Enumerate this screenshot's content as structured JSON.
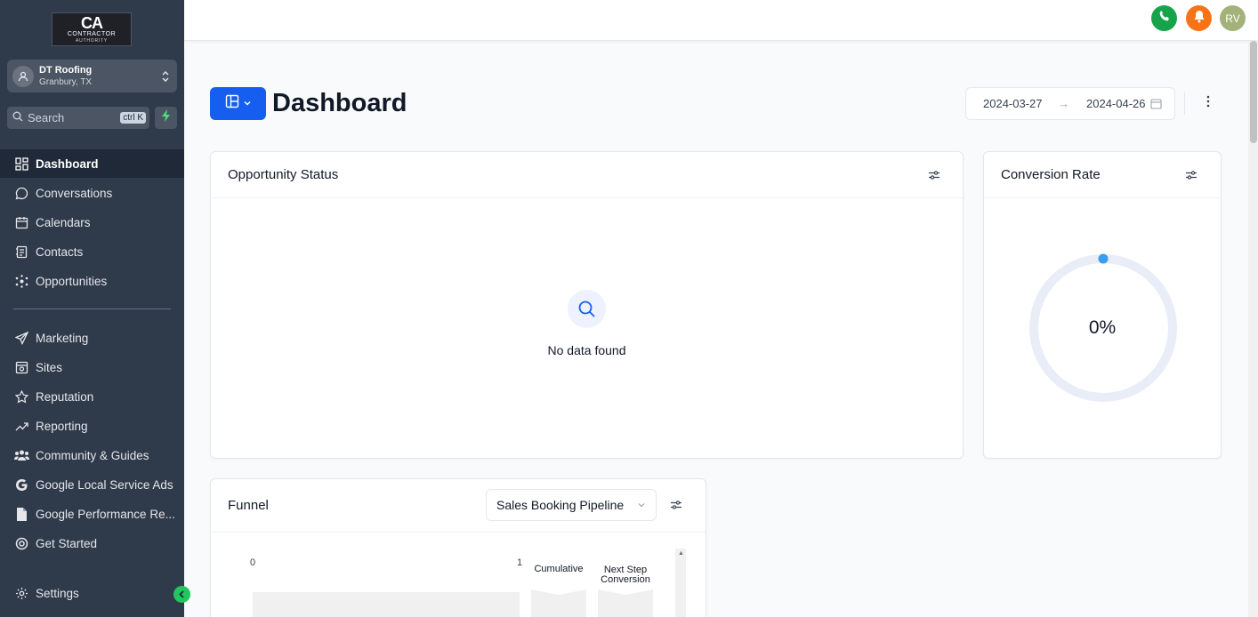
{
  "sidebar": {
    "logo": {
      "main": "CA",
      "sub": "CONTRACTOR",
      "sub2": "AUTHORITY"
    },
    "account": {
      "name": "DT Roofing",
      "location": "Granbury, TX"
    },
    "search": {
      "placeholder": "Search",
      "shortcut": "ctrl K"
    },
    "nav_primary": [
      {
        "label": "Dashboard",
        "icon": "dashboard-icon",
        "active": true
      },
      {
        "label": "Conversations",
        "icon": "chat-icon"
      },
      {
        "label": "Calendars",
        "icon": "calendar-icon"
      },
      {
        "label": "Contacts",
        "icon": "contacts-icon"
      },
      {
        "label": "Opportunities",
        "icon": "opportunities-icon"
      }
    ],
    "nav_secondary": [
      {
        "label": "Marketing",
        "icon": "send-icon"
      },
      {
        "label": "Sites",
        "icon": "sites-icon"
      },
      {
        "label": "Reputation",
        "icon": "star-icon"
      },
      {
        "label": "Reporting",
        "icon": "trend-icon"
      },
      {
        "label": "Community & Guides",
        "icon": "community-icon"
      },
      {
        "label": "Google Local Service Ads",
        "icon": "google-icon"
      },
      {
        "label": "Google Performance Re...",
        "icon": "document-icon"
      },
      {
        "label": "Get Started",
        "icon": "target-icon"
      }
    ],
    "settings_label": "Settings"
  },
  "topbar": {
    "avatar_initials": "RV",
    "colors": {
      "phone": "#16a34a",
      "bell": "#f97316",
      "avatar": "#a3b27a"
    }
  },
  "header": {
    "title": "Dashboard",
    "date_start": "2024-03-27",
    "date_arrow": "→",
    "date_end": "2024-04-26"
  },
  "opportunity_status": {
    "title": "Opportunity Status",
    "empty_message": "No data found"
  },
  "conversion_rate": {
    "title": "Conversion Rate",
    "value_label": "0%",
    "value": 0
  },
  "funnel": {
    "title": "Funnel",
    "pipeline": "Sales Booking Pipeline",
    "axis_min": "0",
    "axis_max": "1",
    "column_cumulative": "Cumulative",
    "column_next_step": "Next Step Conversion"
  },
  "theme": {
    "primary": "#155eef",
    "sidebar_bg": "#2f3a4a",
    "collapse_btn": "#22c55e"
  }
}
